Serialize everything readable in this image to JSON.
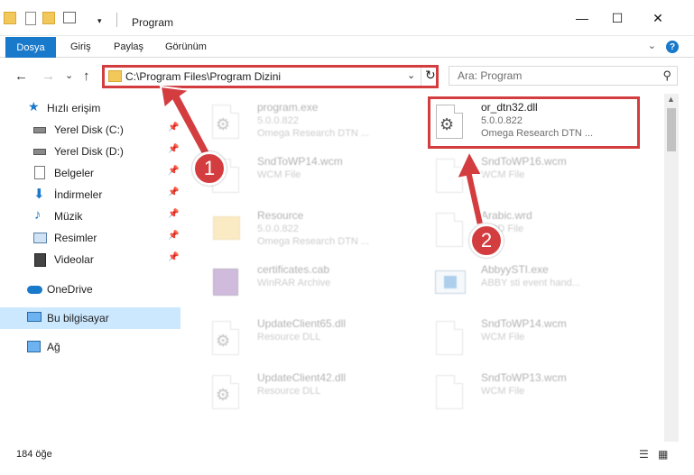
{
  "window": {
    "title": "Program",
    "minimize": "—",
    "maximize": "☐",
    "close": "✕"
  },
  "ribbon": {
    "file_tab": "Dosya",
    "tabs": [
      "Giriş",
      "Paylaş",
      "Görünüm"
    ],
    "help": "?"
  },
  "nav": {
    "back": "←",
    "forward": "→",
    "recent": "⌄",
    "up": "↑",
    "address": "C:\\Program Files\\Program Dizini",
    "dropdown": "⌄",
    "refresh": "↻",
    "search_placeholder": "Ara: Program",
    "search_icon": "⚲"
  },
  "sidebar": {
    "items": [
      {
        "label": "Hızlı erişim",
        "icon": "star-icon",
        "pinned": false
      },
      {
        "label": "Yerel Disk (C:)",
        "icon": "drive-icon",
        "pinned": true
      },
      {
        "label": "Yerel Disk (D:)",
        "icon": "drive-icon",
        "pinned": true
      },
      {
        "label": "Belgeler",
        "icon": "documents-icon",
        "pinned": true
      },
      {
        "label": "İndirmeler",
        "icon": "download-icon",
        "pinned": true
      },
      {
        "label": "Müzik",
        "icon": "music-icon",
        "pinned": true
      },
      {
        "label": "Resimler",
        "icon": "pictures-icon",
        "pinned": true
      },
      {
        "label": "Videolar",
        "icon": "videos-icon",
        "pinned": true
      },
      {
        "label": "OneDrive",
        "icon": "cloud-icon",
        "pinned": false
      },
      {
        "label": "Bu bilgisayar",
        "icon": "computer-icon",
        "pinned": false,
        "selected": true
      },
      {
        "label": "Ağ",
        "icon": "network-icon",
        "pinned": false
      }
    ],
    "pin_glyph": "📌"
  },
  "files": [
    {
      "name": "program.exe",
      "line2": "5.0.0.822",
      "line3": "Omega Research DTN ...",
      "icon": "exe-icon"
    },
    {
      "name": "or_dtn32.dll",
      "line2": "5.0.0.822",
      "line3": "Omega Research DTN ...",
      "icon": "dll-gear-icon"
    },
    {
      "name": "SndToWP14.wcm",
      "line2": "WCM File",
      "line3": "",
      "icon": "blank-file-icon"
    },
    {
      "name": "SndToWP16.wcm",
      "line2": "WCM File",
      "line3": "",
      "icon": "blank-file-icon"
    },
    {
      "name": "Resource",
      "line2": "5.0.0.822",
      "line3": "Omega Research DTN ...",
      "icon": "folder-icon"
    },
    {
      "name": "Arabic.wrd",
      "line2": "WRD File",
      "line3": "",
      "icon": "blank-file-icon"
    },
    {
      "name": "certificates.cab",
      "line2": "WinRAR Archive",
      "line3": "",
      "icon": "archive-icon"
    },
    {
      "name": "AbbyySTI.exe",
      "line2": "ABBY sti event hand...",
      "line3": "",
      "icon": "app-icon"
    },
    {
      "name": "UpdateClient65.dll",
      "line2": "Resource DLL",
      "line3": "",
      "icon": "dll-gear-icon"
    },
    {
      "name": "SndToWP14.wcm",
      "line2": "WCM File",
      "line3": "",
      "icon": "blank-file-icon"
    },
    {
      "name": "UpdateClient42.dll",
      "line2": "Resource DLL",
      "line3": "",
      "icon": "dll-gear-icon"
    },
    {
      "name": "SndToWP13.wcm",
      "line2": "WCM File",
      "line3": "",
      "icon": "blank-file-icon"
    }
  ],
  "annotations": {
    "badge1": "1",
    "badge2": "2",
    "color": "#d33d3f"
  },
  "status": {
    "count": "184 öğe",
    "details_view": "☰",
    "icons_view": "▦"
  }
}
